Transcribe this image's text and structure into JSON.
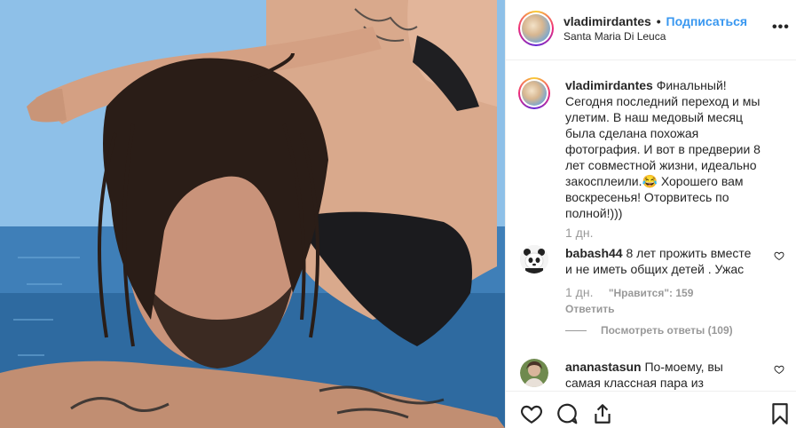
{
  "header": {
    "username": "vladimirdantes",
    "separator": "•",
    "follow_label": "Подписаться",
    "location": "Santa Maria Di Leuca",
    "more_label": "•••"
  },
  "caption": {
    "username": "vladimirdantes",
    "text": "Финальный! Сегодня последний переход и мы улетим. В наш медовый месяц была сделана похожая фотография. И вот в предверии 8 лет совместной жизни, идеально закосплеили.😂 Хорошего вам воскресенья! Оторвитесь по полной!)))",
    "time": "1 дн."
  },
  "comments": [
    {
      "username": "babash44",
      "text": "8 лет прожить вместе и не иметь общих детей . Ужас",
      "time": "1 дн.",
      "likes": "\"Нравится\": 159",
      "reply_label": "Ответить",
      "view_replies": "Посмотреть ответы (109)"
    },
    {
      "username": "ananastasun",
      "text": "По-моему, вы самая классная пара из"
    }
  ],
  "icons": {
    "like": "heart-icon",
    "comment": "comment-icon",
    "share": "share-icon",
    "save": "bookmark-icon"
  },
  "colors": {
    "follow": "#3897f0",
    "muted": "#999999",
    "text": "#262626"
  }
}
